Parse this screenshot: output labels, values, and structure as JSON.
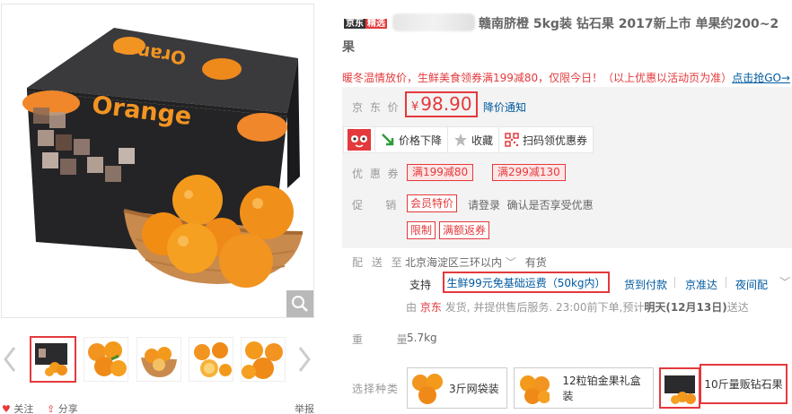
{
  "gallery": {
    "box_text": "Orange",
    "thumb_count": 5,
    "social": {
      "follow": "关注",
      "share": "分享",
      "report": "举报"
    }
  },
  "product": {
    "badge_left": "京东",
    "badge_right": "精选",
    "title_line1": "赣南脐橙 5kg装 钻石果 2017新上市 单果约200~2",
    "title_line2": "果",
    "promo_text": "暖冬温情放价，生鲜美食领券满199减80，仅限今日！（以上优惠以活动页为准）",
    "promo_link": "点击抢GO→"
  },
  "price": {
    "label": "京 东 价",
    "currency": "¥",
    "amount": "98.90",
    "notice": "降价通知"
  },
  "actions": {
    "drop": "价格下降",
    "fav": "收藏",
    "qr": "扫码领优惠券"
  },
  "coupons": {
    "label": "优 惠 券",
    "items": [
      "满199减80",
      "满299减130"
    ]
  },
  "promotion": {
    "label": "促    销",
    "tag_member": "会员特价",
    "member_text": "请登录  确认是否享受优惠",
    "tag_limit": "限制",
    "tag_return": "满额返券"
  },
  "delivery": {
    "label": "配 送 至",
    "address": "北京海淀区三环以内",
    "stock": "有货",
    "support_label": "支持",
    "service_main": "生鲜99元免基础运费（50kg内）",
    "services": [
      "货到付款",
      "京准达",
      "夜间配"
    ],
    "ship_from": "由",
    "ship_jd": "京东",
    "ship_rest": "发货, 并提供售后服务. 23:00前下单,预计",
    "ship_date": "明天(12月13日)",
    "ship_end": "送达"
  },
  "weight": {
    "label": "重  量",
    "value": "5.7kg"
  },
  "variants": {
    "label": "选择种类",
    "items": [
      "3斤网袋装",
      "12粒铂金果礼盒装",
      "10斤量贩钻石果"
    ]
  },
  "colors": {
    "accent": "#e4393c",
    "link": "#005aa0",
    "box_dark": "#2b2b2e",
    "orange": "#f29422"
  }
}
